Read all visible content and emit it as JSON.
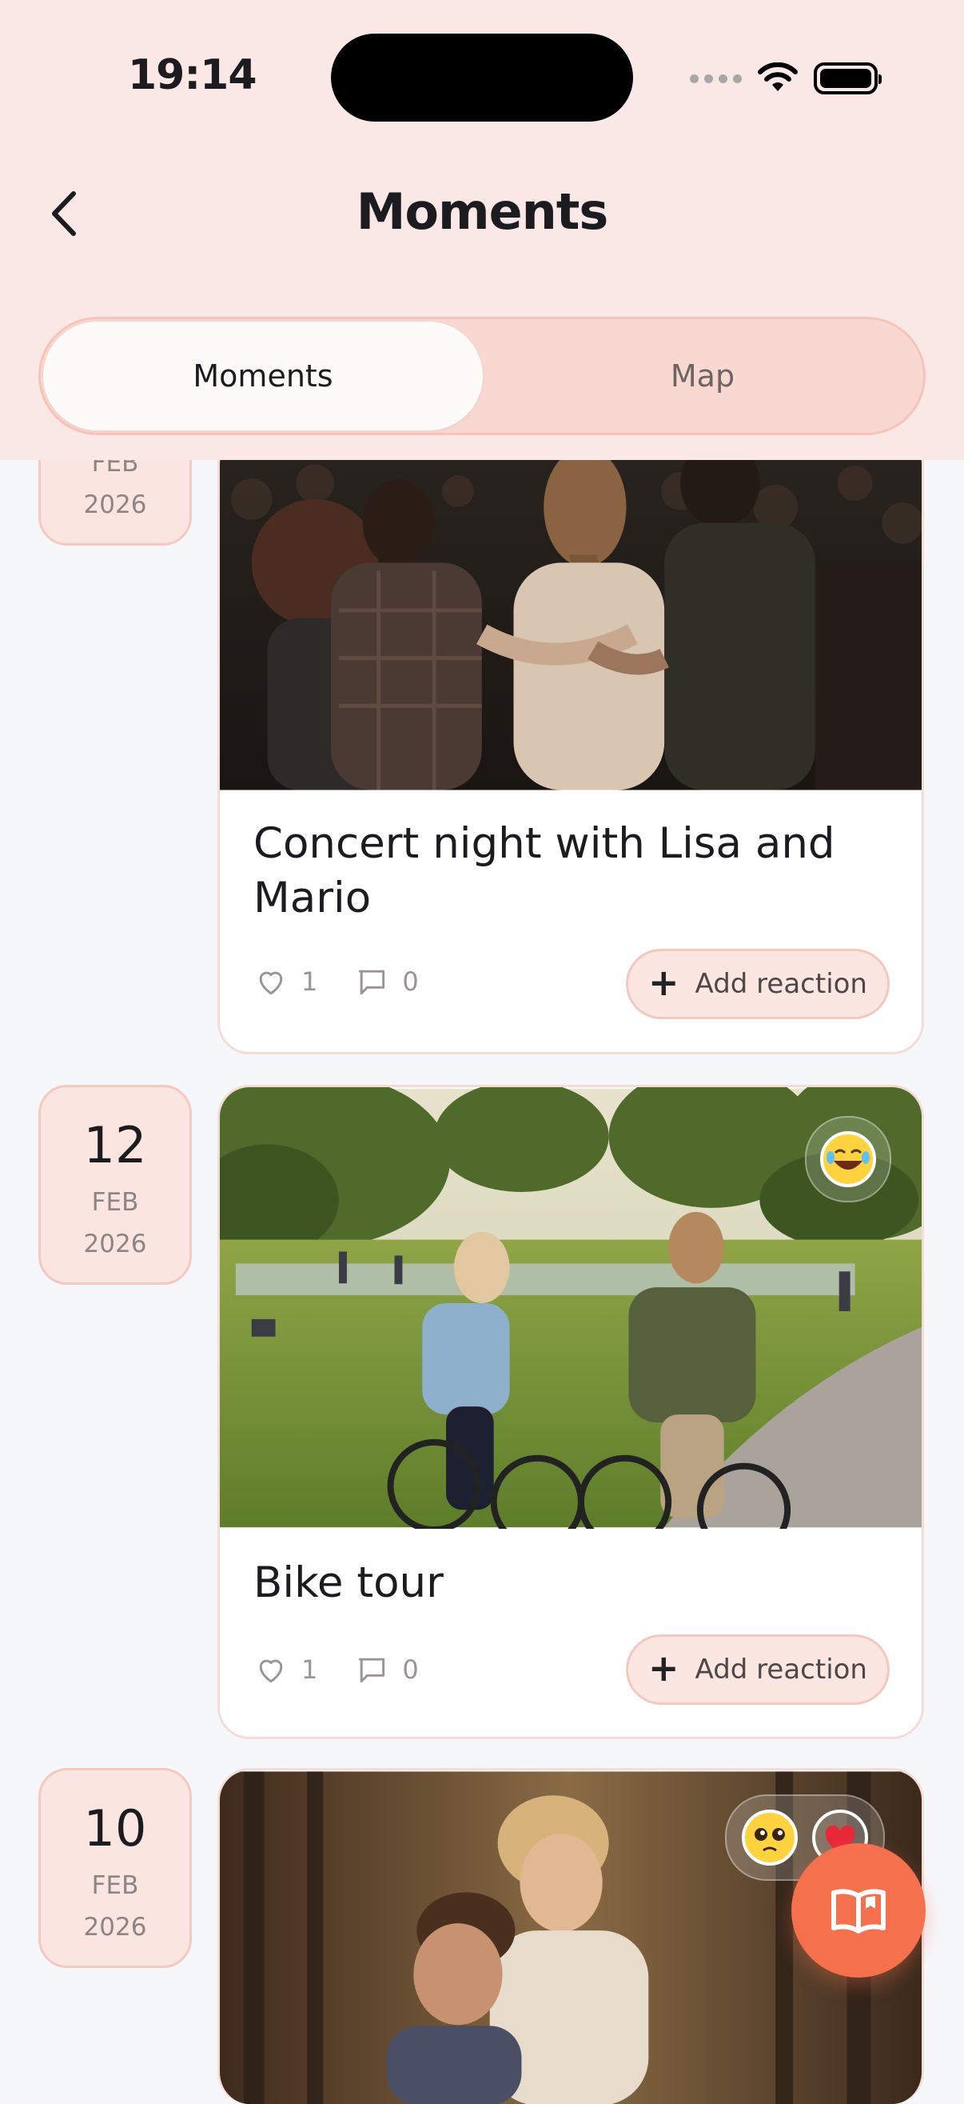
{
  "status_bar": {
    "time": "19:14"
  },
  "header": {
    "title": "Moments",
    "tabs": [
      {
        "label": "Moments",
        "active": true
      },
      {
        "label": "Map",
        "active": false
      }
    ]
  },
  "moments": [
    {
      "date": {
        "day": "",
        "month": "FEB",
        "year": "2026"
      },
      "title": "Concert night with Lisa and Mario",
      "likes": "1",
      "comments": "0",
      "reaction_button": "Add reaction",
      "photo_icon": "concert-crowd-photo"
    },
    {
      "date": {
        "day": "12",
        "month": "FEB",
        "year": "2026"
      },
      "title": "Bike tour",
      "likes": "1",
      "comments": "0",
      "reaction_button": "Add reaction",
      "photo_icon": "park-bike-photo",
      "reactions": [
        "laughing-emoji"
      ]
    },
    {
      "date": {
        "day": "10",
        "month": "FEB",
        "year": "2026"
      },
      "photo_icon": "forest-couple-photo",
      "reactions": [
        "pleading-emoji",
        "heart-emoji"
      ]
    }
  ],
  "fab": {
    "icon": "open-book-icon"
  },
  "colors": {
    "header_bg": "#f9e8e6",
    "page_bg": "#f6f7fb",
    "badge_bg": "#fbe5e1",
    "accent": "#f5704c"
  }
}
